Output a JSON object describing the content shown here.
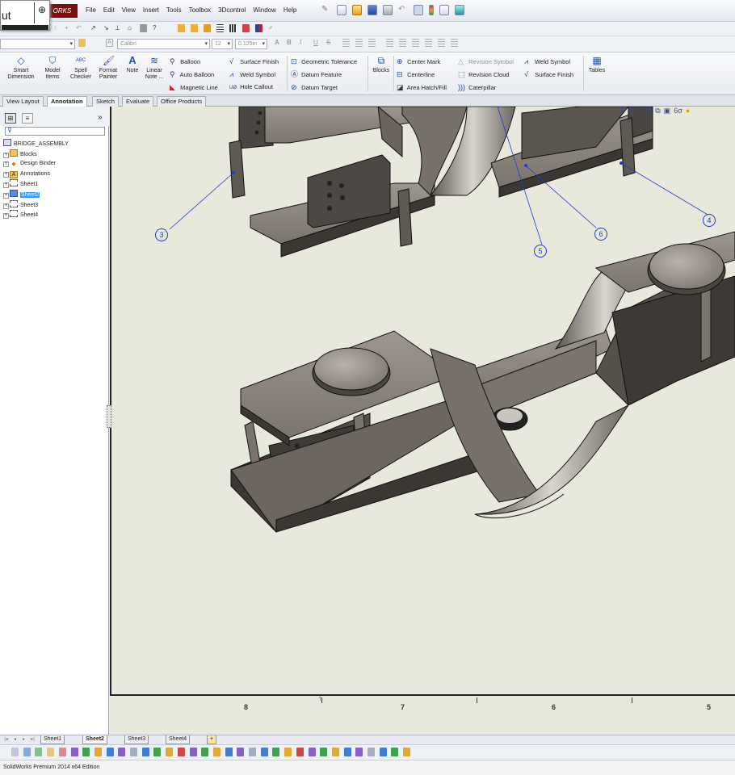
{
  "app": {
    "logo": "ORKS",
    "menus": [
      "File",
      "Edit",
      "View",
      "Insert",
      "Tools",
      "Toolbox",
      "3Dcontrol",
      "Window",
      "Help"
    ]
  },
  "popup": {
    "text": "ut"
  },
  "format": {
    "font": "Calibri",
    "size": "12",
    "height": "0.125in"
  },
  "ribbon": {
    "smart_dimension": [
      "Smart",
      "Dimension"
    ],
    "model_items": [
      "Model",
      "Items"
    ],
    "spell_checker": [
      "Spell",
      "Checker"
    ],
    "format_painter": [
      "Format",
      "Painter"
    ],
    "note": "Note",
    "linear_note": [
      "Linear",
      "Note ..."
    ],
    "col1": [
      "Balloon",
      "Auto Balloon",
      "Magnetic Line"
    ],
    "col2": [
      "Surface Finish",
      "Weld Symbol",
      "Hole Callout"
    ],
    "col3": [
      "Geometric Tolerance",
      "Datum Feature",
      "Datum Target"
    ],
    "blocks": "Blocks",
    "col4": [
      "Center Mark",
      "Centerline",
      "Area Hatch/Fill"
    ],
    "col5": [
      "Revision Symbol",
      "Revision Cloud",
      "Caterpillar"
    ],
    "col6": [
      "Weld Symbol",
      "Surface Finish"
    ],
    "tables": "Tables"
  },
  "tabs": [
    "View Layout",
    "Annotation",
    "Sketch",
    "Evaluate",
    "Office Products"
  ],
  "active_tab": "Annotation",
  "tree": {
    "root": "BRIDGE_ASSEMBLY",
    "items": [
      "Blocks",
      "Design Binder",
      "Annotations",
      "Sheet1",
      "Sheet2",
      "Sheet3",
      "Sheet4"
    ],
    "selected": "Sheet2"
  },
  "balloons": [
    "3",
    "4",
    "5",
    "6"
  ],
  "zones": [
    "8",
    "7",
    "6",
    "5"
  ],
  "sheet_tabs": [
    "Sheet1",
    "Sheet2",
    "Sheet3",
    "Sheet4"
  ],
  "active_sheet": "Sheet2",
  "status": "SolidWorks Premium 2014 x64 Edition",
  "colors": {
    "logo_bg": "#7a0f12",
    "selection": "#3399ff",
    "balloon": "#1e3cc8",
    "sheet_bg": "#e9e8dc",
    "part_dark": "#3d3a36",
    "part_light": "#8c8680"
  }
}
